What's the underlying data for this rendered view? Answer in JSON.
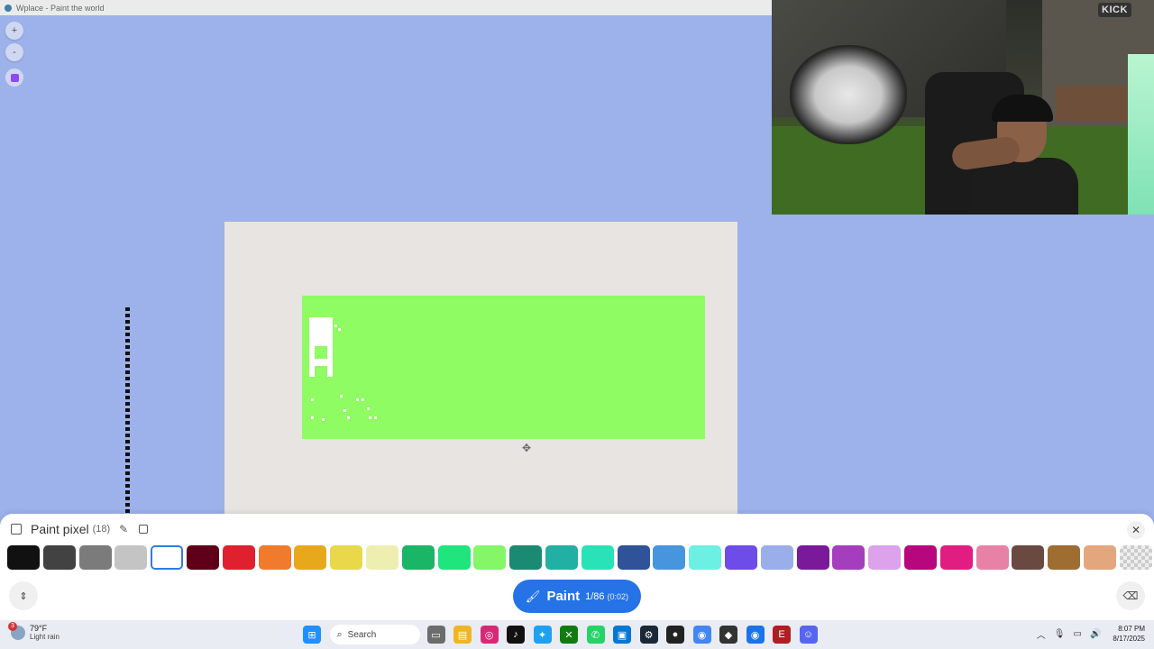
{
  "browser": {
    "tab_title": "Wplace - Paint the world"
  },
  "map_controls": {
    "zoom_in": "+",
    "zoom_out": "-"
  },
  "webcam": {
    "overlay_logo": "KICK"
  },
  "paint_panel": {
    "title": "Paint pixel",
    "count": "(18)",
    "palette": [
      "#111111",
      "#424242",
      "#7b7b7b",
      "#c4c4c4",
      "#ffffff",
      "#600018",
      "#e0202e",
      "#f07b2d",
      "#e8a81b",
      "#e8d84a",
      "#eeeeb0",
      "#1bb566",
      "#20e47c",
      "#84f668",
      "#1a8a73",
      "#23b0a4",
      "#29e2b8",
      "#2f5299",
      "#4795dd",
      "#6cf0e4",
      "#6d4ce8",
      "#9aaeea",
      "#7a1a9a",
      "#a53ebd",
      "#dca2ec",
      "#b8077c",
      "#e21d82",
      "#e782a6",
      "#6a4a40",
      "#9d6d32",
      "#e4a67d",
      "transparent"
    ],
    "selected_index": 4,
    "paint_button": {
      "label": "Paint",
      "charges": "1/86",
      "timer": "(0:02)"
    }
  },
  "taskbar": {
    "weather": {
      "temp": "79°F",
      "condition": "Light rain",
      "badge": "3"
    },
    "search_label": "Search",
    "clock": {
      "time": "8:07 PM",
      "date": "8/17/2025"
    }
  }
}
